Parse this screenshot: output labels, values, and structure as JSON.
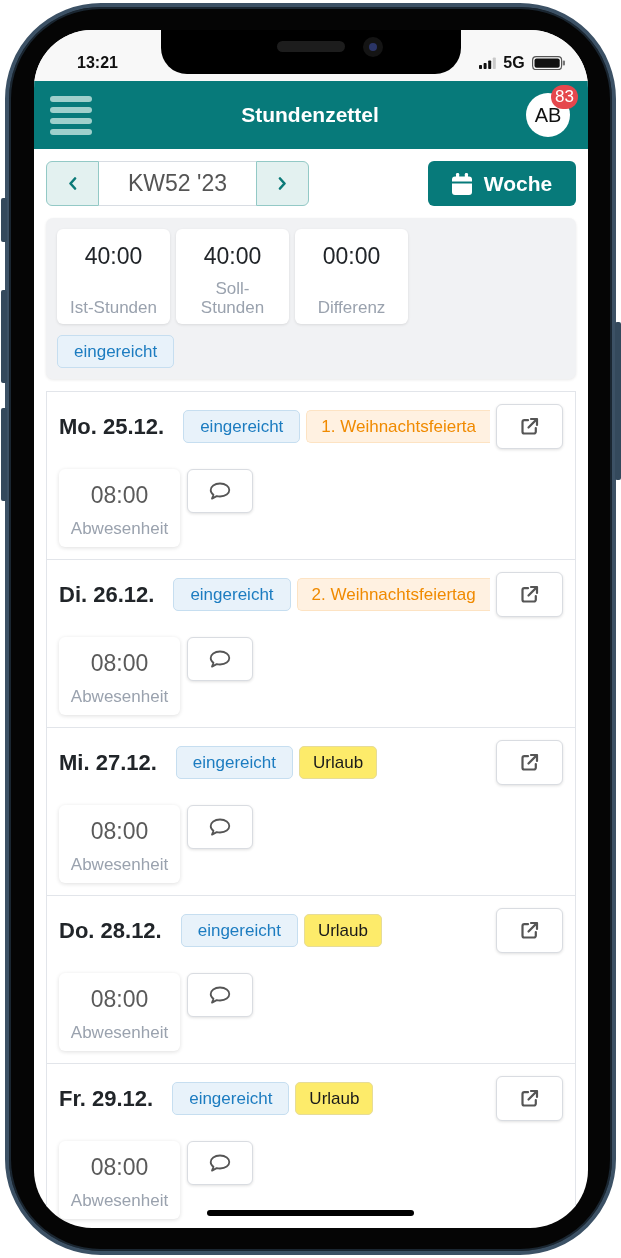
{
  "status_bar": {
    "time": "13:21",
    "network": "5G"
  },
  "header": {
    "title": "Stundenzettel",
    "avatar": {
      "initials": "AB",
      "badge": "83"
    }
  },
  "week_nav": {
    "week": "KW52 '23",
    "view_button": "Woche"
  },
  "summary": {
    "stats": [
      {
        "value": "40:00",
        "label": "Ist-Stunden"
      },
      {
        "value": "40:00",
        "label": "Soll-Stunden"
      },
      {
        "value": "00:00",
        "label": "Differenz"
      }
    ],
    "tags": [
      {
        "label": "eingereicht",
        "kind": "status"
      }
    ]
  },
  "days": [
    {
      "date": "Mo. 25.12.",
      "tags": [
        {
          "label": "eingereicht",
          "kind": "status"
        },
        {
          "label": "1. Weihnachtsfeierta",
          "kind": "holiday"
        }
      ],
      "entries": [
        {
          "value": "08:00",
          "label": "Abwesenheit"
        }
      ]
    },
    {
      "date": "Di. 26.12.",
      "tags": [
        {
          "label": "eingereicht",
          "kind": "status"
        },
        {
          "label": "2. Weihnachtsfeiertag",
          "kind": "holiday"
        }
      ],
      "entries": [
        {
          "value": "08:00",
          "label": "Abwesenheit"
        }
      ]
    },
    {
      "date": "Mi. 27.12.",
      "tags": [
        {
          "label": "eingereicht",
          "kind": "status"
        },
        {
          "label": "Urlaub",
          "kind": "vacation"
        }
      ],
      "entries": [
        {
          "value": "08:00",
          "label": "Abwesenheit"
        }
      ]
    },
    {
      "date": "Do. 28.12.",
      "tags": [
        {
          "label": "eingereicht",
          "kind": "status"
        },
        {
          "label": "Urlaub",
          "kind": "vacation"
        }
      ],
      "entries": [
        {
          "value": "08:00",
          "label": "Abwesenheit"
        }
      ]
    },
    {
      "date": "Fr. 29.12.",
      "tags": [
        {
          "label": "eingereicht",
          "kind": "status"
        },
        {
          "label": "Urlaub",
          "kind": "vacation"
        }
      ],
      "entries": [
        {
          "value": "08:00",
          "label": "Abwesenheit"
        }
      ]
    }
  ]
}
